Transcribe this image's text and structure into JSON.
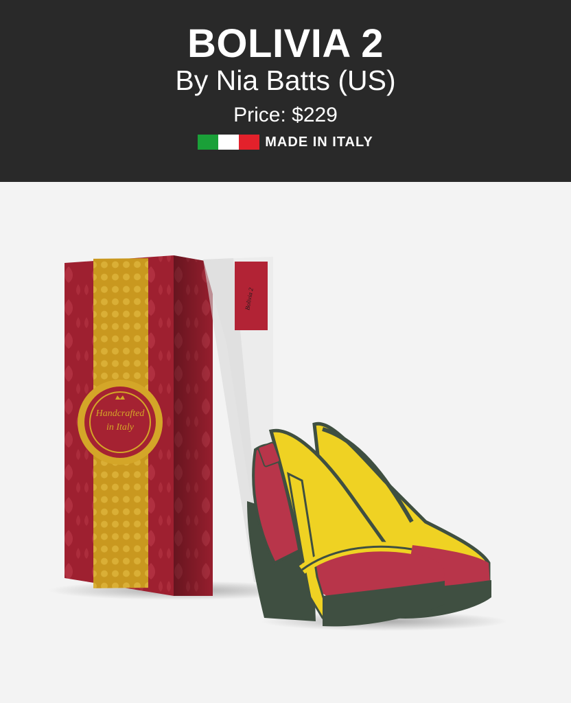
{
  "header": {
    "title": "BOLIVIA 2",
    "author": "By Nia Batts (US)",
    "price": "Price: $229",
    "made_in": "MADE IN ITALY",
    "flag_colors": [
      "#1aa038",
      "#ffffff",
      "#e3212b"
    ]
  },
  "box": {
    "seal_text_1": "Handcrafted",
    "seal_text_2": "in Italy",
    "label_text": "Bolivia 2"
  },
  "colors": {
    "header_bg": "#292929",
    "page_bg": "#f3f3f3",
    "box_red": "#9e2030",
    "box_gold": "#d4a628",
    "shoe_yellow": "#efd223",
    "shoe_red": "#b8354a",
    "shoe_green": "#3f4f41"
  }
}
